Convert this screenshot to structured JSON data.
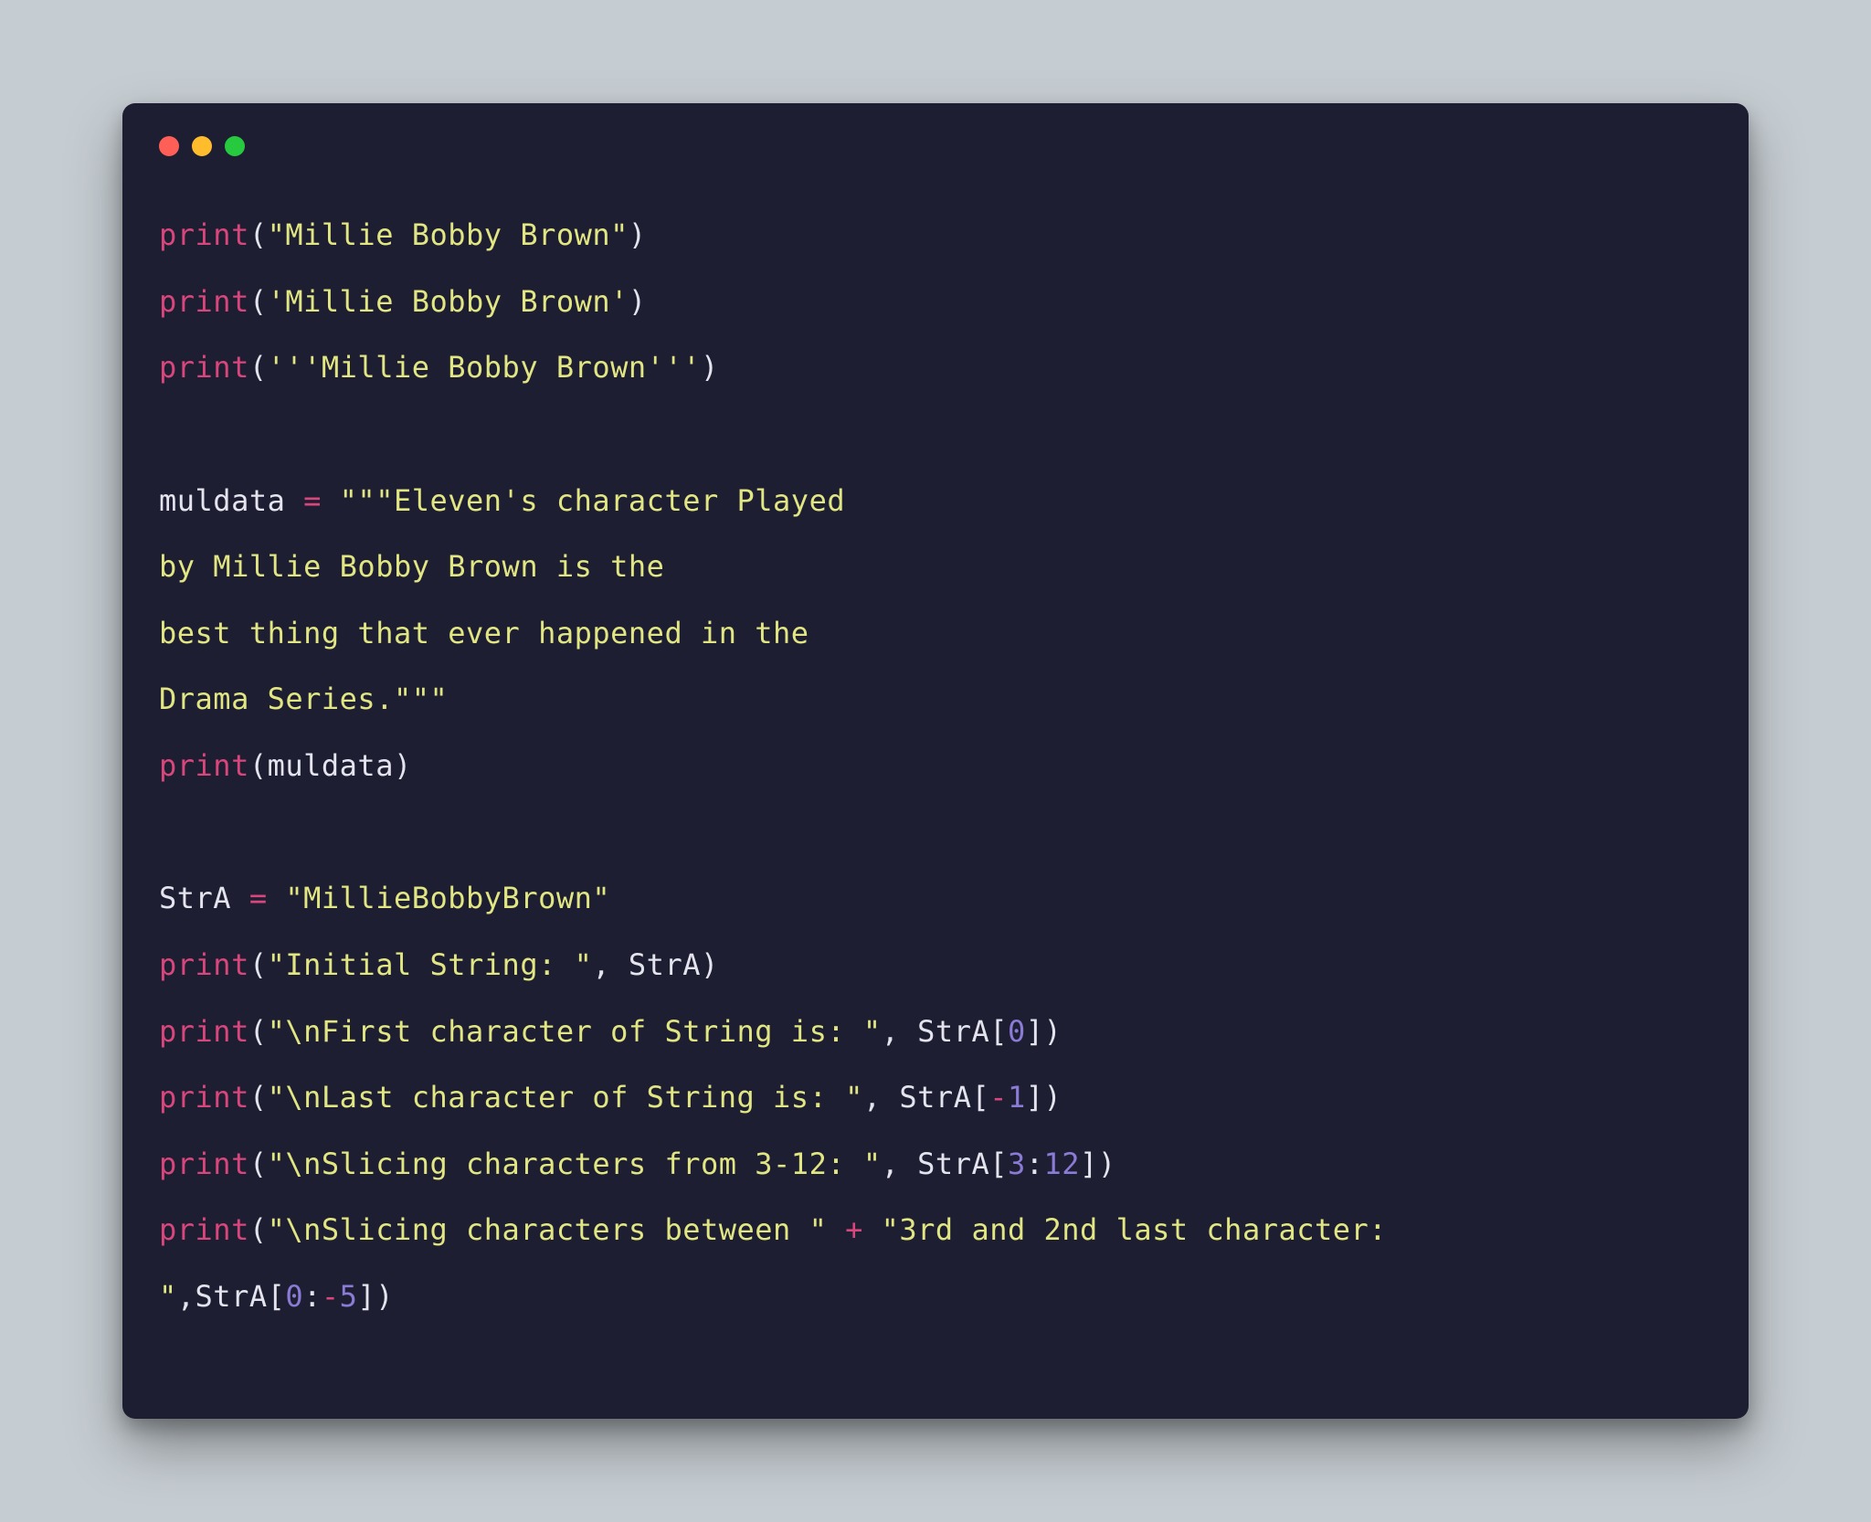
{
  "traffic_lights": {
    "red": "#ff5f56",
    "yellow": "#ffbd2e",
    "green": "#27c93f"
  },
  "code": {
    "l1": {
      "fn": "print",
      "po": "(",
      "s": "\"Millie Bobby Brown\"",
      "pc": ")"
    },
    "l2": {
      "fn": "print",
      "po": "(",
      "s": "'Millie Bobby Brown'",
      "pc": ")"
    },
    "l3": {
      "fn": "print",
      "po": "(",
      "s": "'''Millie Bobby Brown'''",
      "pc": ")"
    },
    "l4": "",
    "l5": {
      "var": "muldata ",
      "op": "=",
      "s": " \"\"\"Eleven's character Played "
    },
    "l6": "by Millie Bobby Brown is the ",
    "l7": "best thing that ever happened in the ",
    "l8": "Drama Series.\"\"\"",
    "l9": {
      "fn": "print",
      "po": "(",
      "v": "muldata",
      "pc": ")"
    },
    "l10": "",
    "l11": {
      "var": "StrA ",
      "op": "=",
      "s": " \"MillieBobbyBrown\""
    },
    "l12": {
      "fn": "print",
      "po": "(",
      "s": "\"Initial String: \"",
      "t": ", StrA",
      "pc": ")"
    },
    "l13": {
      "fn": "print",
      "po": "(",
      "s": "\"\\nFirst character of String is: \"",
      "t1": ", StrA",
      "bo": "[",
      "n": "0",
      "bc": "]",
      "pc": ")"
    },
    "l14": {
      "fn": "print",
      "po": "(",
      "s": "\"\\nLast character of String is: \"",
      "t1": ", StrA",
      "bo": "[",
      "op2": "-",
      "n": "1",
      "bc": "]",
      "pc": ")"
    },
    "l15": {
      "fn": "print",
      "po": "(",
      "s": "\"\\nSlicing characters from 3-12: \"",
      "t1": ", StrA",
      "bo": "[",
      "n1": "3",
      "colon": ":",
      "n2": "12",
      "bc": "]",
      "pc": ")"
    },
    "l16": {
      "fn": "print",
      "po": "(",
      "s1": "\"\\nSlicing characters between \"",
      "plus": " + ",
      "s2": "\"3rd and 2nd last character: "
    },
    "l17": {
      "s": "\"",
      "t1": ",StrA",
      "bo": "[",
      "n1": "0",
      "colon": ":",
      "op2": "-",
      "n2": "5",
      "bc": "]",
      "pc": ")"
    }
  }
}
